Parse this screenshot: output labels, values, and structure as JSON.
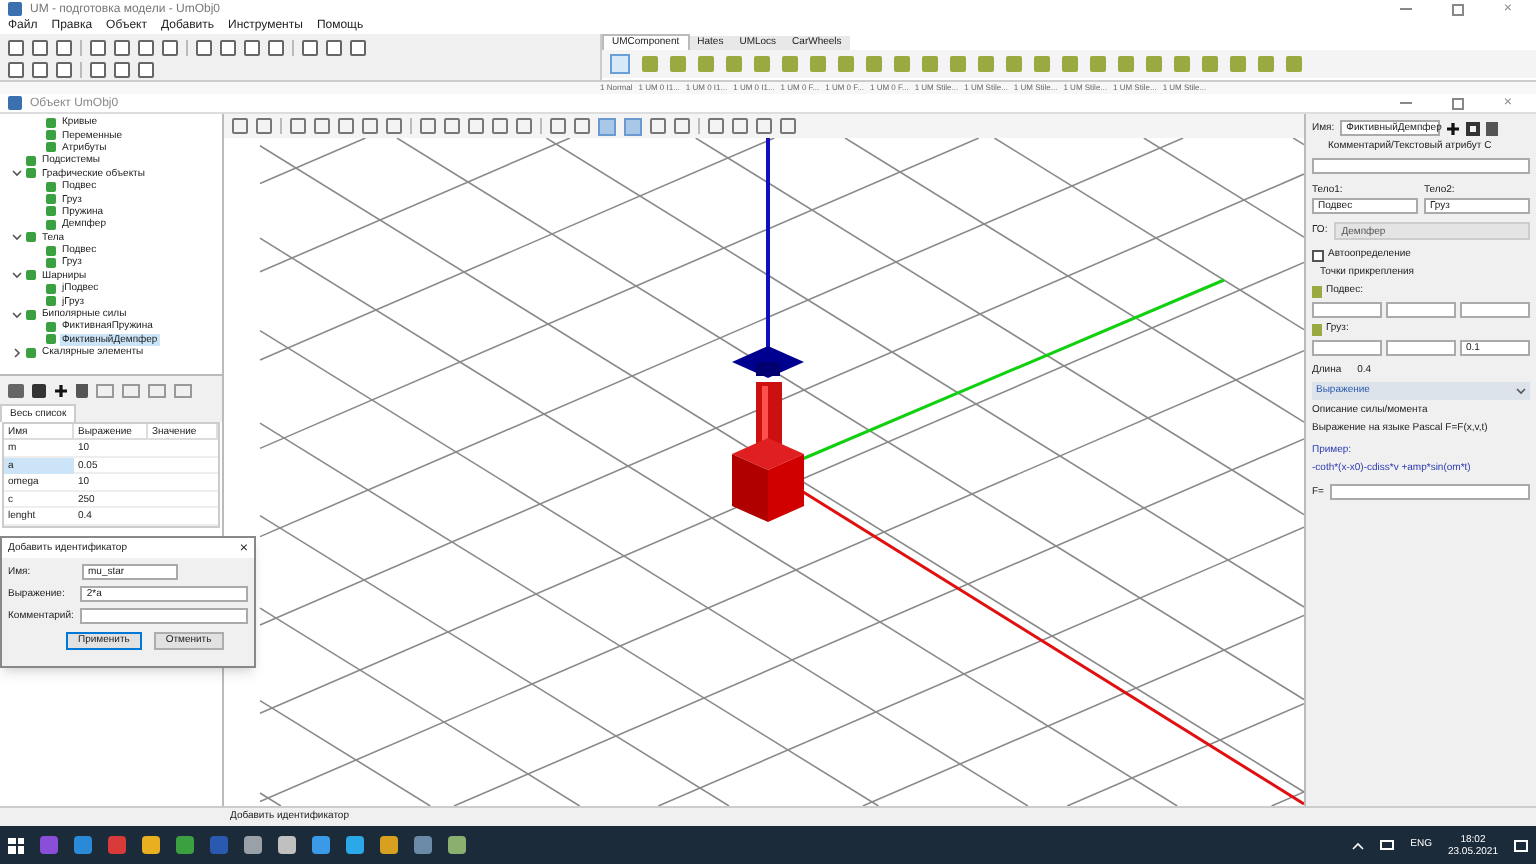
{
  "window": {
    "title": "UM - подготовка модели - UmObj0",
    "close": "×"
  },
  "menu": [
    "Файл",
    "Правка",
    "Объект",
    "Добавить",
    "Инструменты",
    "Помощь"
  ],
  "component_tabs": [
    {
      "label": "UMComponent",
      "selected": true
    },
    {
      "label": "Hates",
      "selected": false
    },
    {
      "label": "UMLocs",
      "selected": false
    },
    {
      "label": "CarWheels",
      "selected": false
    }
  ],
  "style_tabs": [
    "1 Normal",
    "1 UM 0 I1...",
    "1 UM 0 I1...",
    "1 UM 0 I1...",
    "1 UM 0 F...",
    "1 UM 0 F...",
    "1 UM 0 F...",
    "1 UM Stile...",
    "1 UM Stile...",
    "1 UM Stile...",
    "1 UM Stile...",
    "1 UM Stile...",
    "1 UM Stile..."
  ],
  "object_window": {
    "title": "Объект UmObj0",
    "close": "×"
  },
  "tree": {
    "partial_items": [
      {
        "label": "Кривые",
        "selected": false
      },
      {
        "label": "Переменные",
        "selected": false
      },
      {
        "label": "Атрибуты",
        "selected": false
      }
    ],
    "items": [
      {
        "label": "Подсистемы",
        "selected": false
      },
      {
        "label": "Графические объекты",
        "selected": false,
        "expanded": true,
        "children": [
          {
            "label": "Подвес",
            "selected": false
          },
          {
            "label": "Груз",
            "selected": false
          },
          {
            "label": "Пружина",
            "selected": false
          },
          {
            "label": "Демпфер",
            "selected": false
          }
        ]
      },
      {
        "label": "Тела",
        "selected": false,
        "expanded": true,
        "children": [
          {
            "label": "Подвес",
            "selected": false
          },
          {
            "label": "Груз",
            "selected": false
          }
        ]
      },
      {
        "label": "Шарниры",
        "selected": false,
        "expanded": true,
        "children": [
          {
            "label": "jПодвес",
            "selected": false
          },
          {
            "label": "jГруз",
            "selected": false
          }
        ]
      },
      {
        "label": "Биполярные силы",
        "selected": false,
        "expanded": true,
        "children": [
          {
            "label": "ФиктивнаяПружина",
            "selected": false
          },
          {
            "label": "ФиктивныйДемпфер",
            "selected": true
          }
        ]
      },
      {
        "label": "Скалярные элементы",
        "selected": false,
        "expanded": false
      }
    ]
  },
  "list_tab": "Весь список",
  "table": {
    "columns": [
      "Имя",
      "Выражение",
      "Значение"
    ],
    "rows": [
      {
        "cells": [
          "m",
          "10"
        ],
        "selected": false
      },
      {
        "cells": [
          "a",
          "0.05"
        ],
        "selected": true
      },
      {
        "cells": [
          "omega",
          "10"
        ],
        "selected": false
      },
      {
        "cells": [
          "c",
          "250"
        ],
        "selected": false
      },
      {
        "cells": [
          "lenght",
          "0.4"
        ],
        "selected": false
      }
    ]
  },
  "dialog": {
    "title": "Добавить идентификатор",
    "close": "×",
    "fields": [
      {
        "label": "Имя:",
        "value": "mu_star"
      },
      {
        "label": "Выражение:",
        "value": "2*a"
      },
      {
        "label": "Комментарий:"
      }
    ],
    "buttons": [
      {
        "label": "Применить",
        "default": true
      },
      {
        "label": "Отменить",
        "default": false
      }
    ]
  },
  "inspector": {
    "name_label": "Имя:",
    "name_value": "ФиктивныйДемпфер",
    "comment_label": "Комментарий/Текстовый атрибут С",
    "body1_label": "Тело1:",
    "body2_label": "Тело2:",
    "body1": "Подвес",
    "body2": "Груз",
    "go_label": "ГО:",
    "go_value": "Демпфер",
    "auto": {
      "label": "Автоопределение",
      "checked": false
    },
    "points_label": "Точки прикрепления",
    "points": [
      {
        "label": "Подвес:"
      },
      {
        "label": "Груз:",
        "field_3": "0.1"
      }
    ],
    "length_label": "Длина",
    "length_value": "0.4",
    "section": {
      "label": "Выражение",
      "expanded": true
    },
    "description": [
      "Описание силы/момента",
      "Выражение на языке Pascal F=F(x,v,t)"
    ],
    "example_label": "Пример:",
    "example": "-coth*(x-x0)-cdiss*v +amp*sin(om*t)",
    "f_label": "F="
  },
  "status_bar": "Добавить идентификатор",
  "tray": {
    "language": "ENG",
    "time": "18:02",
    "date": "23.05.2021"
  }
}
